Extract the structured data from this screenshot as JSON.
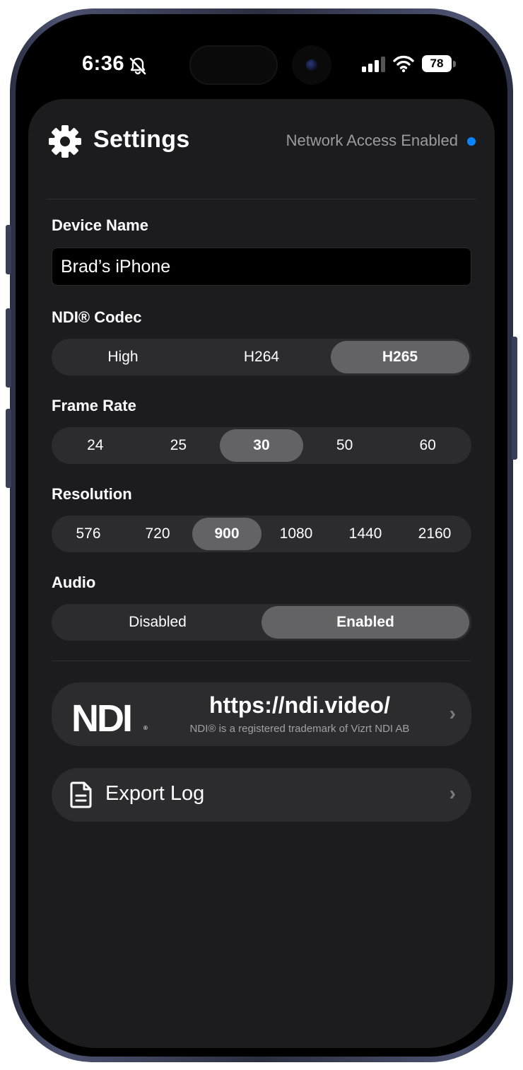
{
  "status_bar": {
    "time": "6:36",
    "battery": "78",
    "icons": [
      "bell-slash-icon",
      "cellular-signal-icon",
      "wifi-icon",
      "battery-icon"
    ]
  },
  "header": {
    "title": "Settings",
    "network_status": "Network Access Enabled",
    "network_dot_color": "#0a84ff",
    "icon": "gear-icon"
  },
  "device_name": {
    "label": "Device Name",
    "value": "Brad’s iPhone"
  },
  "codec": {
    "label": "NDI® Codec",
    "options": [
      "High",
      "H264",
      "H265"
    ],
    "selected": "H265"
  },
  "frame_rate": {
    "label": "Frame Rate",
    "options": [
      "24",
      "25",
      "30",
      "50",
      "60"
    ],
    "selected": "30"
  },
  "resolution": {
    "label": "Resolution",
    "options": [
      "576",
      "720",
      "900",
      "1080",
      "1440",
      "2160"
    ],
    "selected": "900"
  },
  "audio": {
    "label": "Audio",
    "options": [
      "Disabled",
      "Enabled"
    ],
    "selected": "Enabled"
  },
  "ndi_link": {
    "logo_text": "NDI",
    "logo_reg": "®",
    "url": "https://ndi.video/",
    "trademark": "NDI® is a registered trademark of Vizrt NDI AB"
  },
  "export_log": {
    "label": "Export Log",
    "icon": "document-icon"
  },
  "colors": {
    "background": "#1c1c1e",
    "segment_bg": "#2c2c2e",
    "segment_selected": "#636366",
    "accent": "#0a84ff"
  }
}
